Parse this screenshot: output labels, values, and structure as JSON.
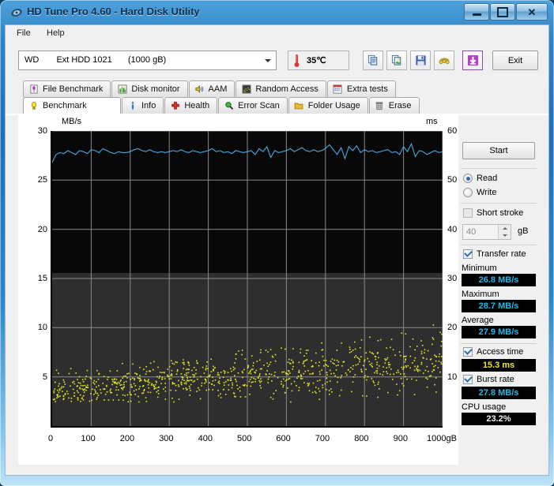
{
  "window": {
    "title": "HD Tune Pro 4.60 - Hard Disk Utility",
    "icon": "disk-icon",
    "controls": {
      "minimize": "–",
      "maximize": "□",
      "close": "✕"
    }
  },
  "menu": {
    "items": [
      {
        "label": "File"
      },
      {
        "label": "Help"
      }
    ]
  },
  "toolbar": {
    "drive": {
      "vendor": "WD",
      "model": "Ext HDD 1021",
      "capacity": "(1000 gB)"
    },
    "temperature": "35℃",
    "buttons": [
      {
        "name": "copy-icon",
        "label": "Copy"
      },
      {
        "name": "copy-image-icon",
        "label": "Copy image"
      },
      {
        "name": "save-icon",
        "label": "Save"
      },
      {
        "name": "options-icon",
        "label": "Options"
      },
      {
        "name": "download-icon",
        "label": "Download"
      }
    ],
    "exit_label": "Exit"
  },
  "tabs": {
    "row1": [
      {
        "label": "File Benchmark",
        "icon": "file-benchmark-icon",
        "active": false
      },
      {
        "label": "Disk monitor",
        "icon": "disk-monitor-icon",
        "active": false
      },
      {
        "label": "AAM",
        "icon": "speaker-icon",
        "active": false
      },
      {
        "label": "Random Access",
        "icon": "random-access-icon",
        "active": false
      },
      {
        "label": "Extra tests",
        "icon": "extra-tests-icon",
        "active": false
      }
    ],
    "row2": [
      {
        "label": "Benchmark",
        "icon": "lightbulb-icon",
        "active": true
      },
      {
        "label": "Info",
        "icon": "info-icon",
        "active": false
      },
      {
        "label": "Health",
        "icon": "health-cross-icon",
        "active": false
      },
      {
        "label": "Error Scan",
        "icon": "magnifier-icon",
        "active": false
      },
      {
        "label": "Folder Usage",
        "icon": "folder-icon",
        "active": false
      },
      {
        "label": "Erase",
        "icon": "trash-icon",
        "active": false
      }
    ]
  },
  "side": {
    "start_label": "Start",
    "mode": {
      "read": "Read",
      "write": "Write",
      "selected": "Read"
    },
    "short_stroke": {
      "label": "Short stroke",
      "checked": false,
      "value": "40",
      "unit": "gB"
    },
    "transfer_rate": {
      "label": "Transfer rate",
      "checked": true
    },
    "minimum": {
      "label": "Minimum",
      "value": "26.8 MB/s"
    },
    "maximum": {
      "label": "Maximum",
      "value": "28.7 MB/s"
    },
    "average": {
      "label": "Average",
      "value": "27.9 MB/s"
    },
    "access_time": {
      "label": "Access time",
      "checked": true,
      "value": "15.3 ms"
    },
    "burst_rate": {
      "label": "Burst rate",
      "checked": true,
      "value": "27.8 MB/s"
    },
    "cpu_usage": {
      "label": "CPU usage",
      "value": "23.2%"
    }
  },
  "colors": {
    "transfer_line": "#4aa8e0",
    "access_dots": "#e8e82a",
    "lcd_bg": "#000000",
    "plot_bg": "#2e2e2e",
    "accent": "#2a6fb5"
  },
  "chart_data": {
    "type": "line",
    "title": "",
    "xlabel": "gB",
    "ylabel": "MB/s",
    "y2label": "ms",
    "xlim": [
      0,
      1000
    ],
    "ylim": [
      0,
      30
    ],
    "y2lim": [
      0,
      60
    ],
    "grid": true,
    "xticks": [
      0,
      100,
      200,
      300,
      400,
      500,
      600,
      700,
      800,
      900,
      1000
    ],
    "xtick_labels": [
      "0",
      "100",
      "200",
      "300",
      "400",
      "500",
      "600",
      "700",
      "800",
      "900",
      "1000gB"
    ],
    "yticks": [
      5,
      10,
      15,
      20,
      25,
      30
    ],
    "y2ticks": [
      10,
      20,
      30,
      40,
      50,
      60
    ],
    "series": [
      {
        "name": "Transfer rate",
        "type": "line",
        "axis": "left",
        "unit": "MB/s",
        "color": "#4aa8e0",
        "x": [
          0,
          10,
          20,
          30,
          40,
          50,
          60,
          70,
          80,
          90,
          100,
          110,
          120,
          130,
          140,
          150,
          160,
          170,
          180,
          190,
          200,
          210,
          220,
          230,
          240,
          250,
          260,
          270,
          280,
          290,
          300,
          310,
          320,
          330,
          340,
          350,
          360,
          370,
          380,
          390,
          400,
          410,
          420,
          430,
          440,
          450,
          460,
          470,
          480,
          490,
          500,
          510,
          520,
          530,
          540,
          550,
          560,
          570,
          580,
          590,
          600,
          610,
          620,
          630,
          640,
          650,
          660,
          670,
          680,
          690,
          700,
          710,
          720,
          730,
          740,
          750,
          760,
          770,
          780,
          790,
          800,
          810,
          820,
          830,
          840,
          850,
          860,
          870,
          880,
          890,
          900,
          910,
          920,
          930,
          940,
          950,
          960,
          970,
          980,
          990,
          1000
        ],
        "values": [
          26.8,
          27.6,
          27.8,
          27.7,
          28.0,
          27.8,
          27.6,
          28.0,
          27.9,
          27.7,
          28.1,
          28.0,
          27.8,
          28.2,
          28.0,
          27.8,
          27.7,
          27.9,
          27.8,
          27.8,
          27.9,
          28.1,
          28.2,
          28.0,
          27.9,
          28.1,
          27.9,
          27.8,
          27.9,
          27.8,
          27.9,
          28.0,
          27.9,
          28.1,
          27.9,
          27.8,
          28.0,
          27.9,
          27.8,
          27.9,
          28.0,
          28.2,
          27.9,
          28.0,
          27.8,
          27.9,
          27.7,
          28.0,
          27.9,
          27.8,
          27.9,
          28.0,
          27.6,
          28.2,
          27.9,
          28.4,
          27.3,
          28.0,
          27.8,
          27.9,
          28.0,
          28.2,
          27.9,
          28.1,
          28.3,
          28.0,
          27.9,
          28.1,
          27.9,
          28.0,
          28.2,
          28.6,
          28.1,
          27.6,
          28.3,
          27.2,
          28.4,
          28.0,
          28.5,
          27.8,
          28.1,
          27.9,
          28.0,
          27.8,
          27.9,
          28.0,
          28.1,
          27.8,
          27.9,
          27.6,
          28.4,
          27.9,
          28.7,
          27.4,
          28.0,
          27.9,
          27.6,
          27.8,
          28.0,
          27.8,
          27.9
        ],
        "statistics": {
          "minimum": 26.8,
          "maximum": 28.7,
          "average": 27.9
        }
      },
      {
        "name": "Access time",
        "type": "scatter",
        "axis": "right",
        "unit": "ms",
        "color": "#e8e82a",
        "average": 15.3,
        "range_ms": [
          6,
          25
        ],
        "trend": "increasing with capacity offset",
        "point_count": 900
      }
    ],
    "burst_rate": 27.8,
    "cpu_usage_percent": 23.2
  }
}
